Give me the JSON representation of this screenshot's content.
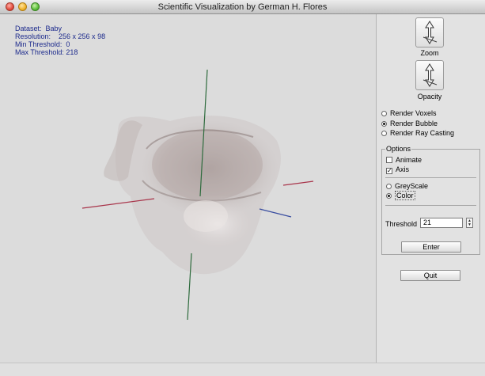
{
  "window": {
    "title": "Scientific Visualization by German H. Flores"
  },
  "info": {
    "dataset": "Dataset:  Baby",
    "resolution": "Resolution:    256 x 256 x 98",
    "min_threshold": "Min Threshold:  0",
    "max_threshold": "Max Threshold: 218"
  },
  "controls": {
    "zoom_label": "Zoom",
    "opacity_label": "Opacity",
    "render_modes": [
      {
        "label": "Render Voxels",
        "selected": false
      },
      {
        "label": "Render Bubble",
        "selected": true
      },
      {
        "label": "Render Ray Casting",
        "selected": false
      }
    ],
    "options": {
      "legend": "Options",
      "animate": {
        "label": "Animate",
        "checked": false
      },
      "axis": {
        "label": "Axis",
        "checked": true,
        "mark": "✓"
      },
      "color_modes": [
        {
          "label": "GreyScale",
          "selected": false
        },
        {
          "label": "Color",
          "selected": true
        }
      ],
      "threshold_label": "Threshold",
      "threshold_value": "21",
      "enter_label": "Enter"
    },
    "quit_label": "Quit"
  },
  "colors": {
    "info_text": "#1c2a8c",
    "axis_green": "#2e6b3d",
    "axis_red": "#a8344a",
    "axis_blue": "#3a4ea0"
  }
}
